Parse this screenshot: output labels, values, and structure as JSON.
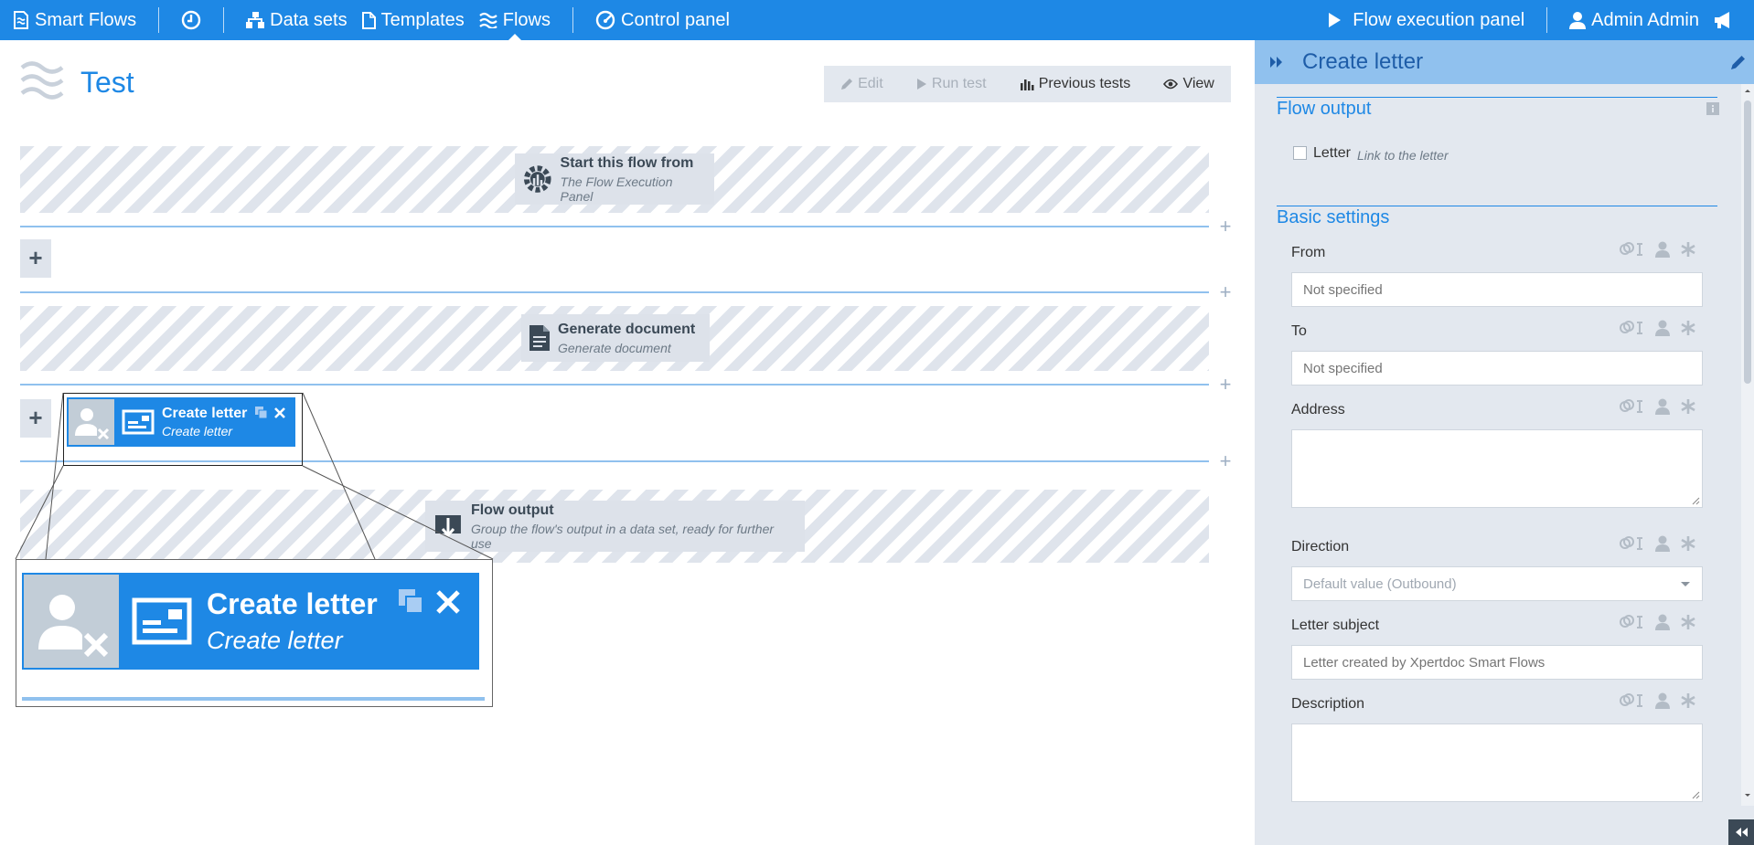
{
  "topbar": {
    "brand": "Smart Flows",
    "nav": [
      "Data sets",
      "Templates",
      "Flows",
      "Control panel"
    ],
    "flow_execution": "Flow execution panel",
    "user": "Admin Admin"
  },
  "page": {
    "title": "Test",
    "toolbar": {
      "edit": "Edit",
      "run_test": "Run test",
      "previous_tests": "Previous tests",
      "view": "View"
    }
  },
  "flow": {
    "start": {
      "title": "Start this flow from",
      "subtitle": "The Flow Execution Panel"
    },
    "generate": {
      "title": "Generate document",
      "subtitle": "Generate document"
    },
    "create_letter": {
      "title": "Create letter",
      "subtitle": "Create letter"
    },
    "output": {
      "title": "Flow output",
      "subtitle": "Group the flow's output in a data set, ready for further use"
    }
  },
  "panel": {
    "title": "Create letter",
    "flow_output": {
      "heading": "Flow output",
      "checkbox_label": "Letter",
      "checkbox_hint": "Link to the letter"
    },
    "basic_settings": {
      "heading": "Basic settings",
      "fields": {
        "from": {
          "label": "From",
          "placeholder": "Not specified"
        },
        "to": {
          "label": "To",
          "placeholder": "Not specified"
        },
        "address": {
          "label": "Address"
        },
        "direction": {
          "label": "Direction",
          "value": "Default value (Outbound)"
        },
        "subject": {
          "label": "Letter subject",
          "placeholder": "Letter created by Xpertdoc Smart Flows"
        },
        "description": {
          "label": "Description"
        }
      }
    }
  },
  "colors": {
    "accent": "#1e88e5",
    "panel_bg": "#e3e8ef",
    "header_light": "#90c1ee"
  }
}
